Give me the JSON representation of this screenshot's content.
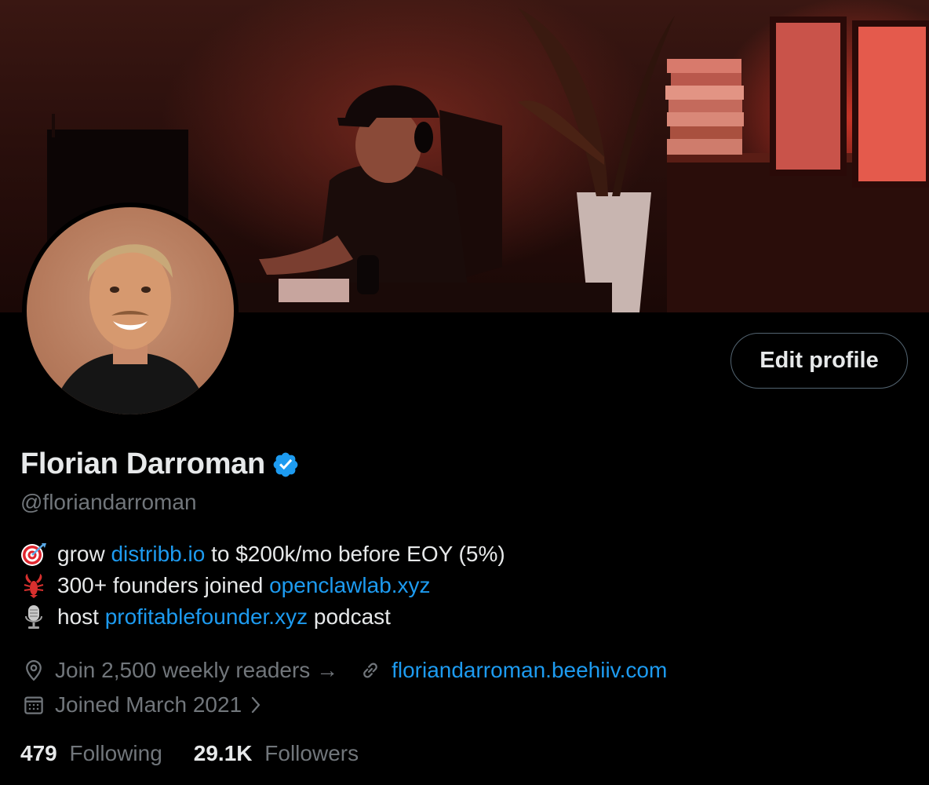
{
  "profile": {
    "name": "Florian Darroman",
    "handle": "@floriandarroman",
    "edit_label": "Edit profile",
    "verified_icon": "verified-badge-icon",
    "bio": [
      {
        "icon": "target-icon",
        "pre": "grow ",
        "link": "distribb.io",
        "post": " to $200k/mo before EOY (5%)"
      },
      {
        "icon": "lobster-icon",
        "pre": "300+ founders joined ",
        "link": "openclawlab.xyz",
        "post": ""
      },
      {
        "icon": "microphone-icon",
        "pre": "host ",
        "link": "profitablefounder.xyz",
        "post": " podcast"
      }
    ],
    "location": "Join 2,500 weekly readers →",
    "website": "floriandarroman.beehiiv.com",
    "joined": "Joined March 2021",
    "following_count": "479",
    "following_label": "Following",
    "followers_count": "29.1K",
    "followers_label": "Followers"
  },
  "colors": {
    "accent": "#1d9bf0",
    "secondary_text": "#71767b",
    "primary_text": "#e7e9ea",
    "background": "#000000"
  }
}
